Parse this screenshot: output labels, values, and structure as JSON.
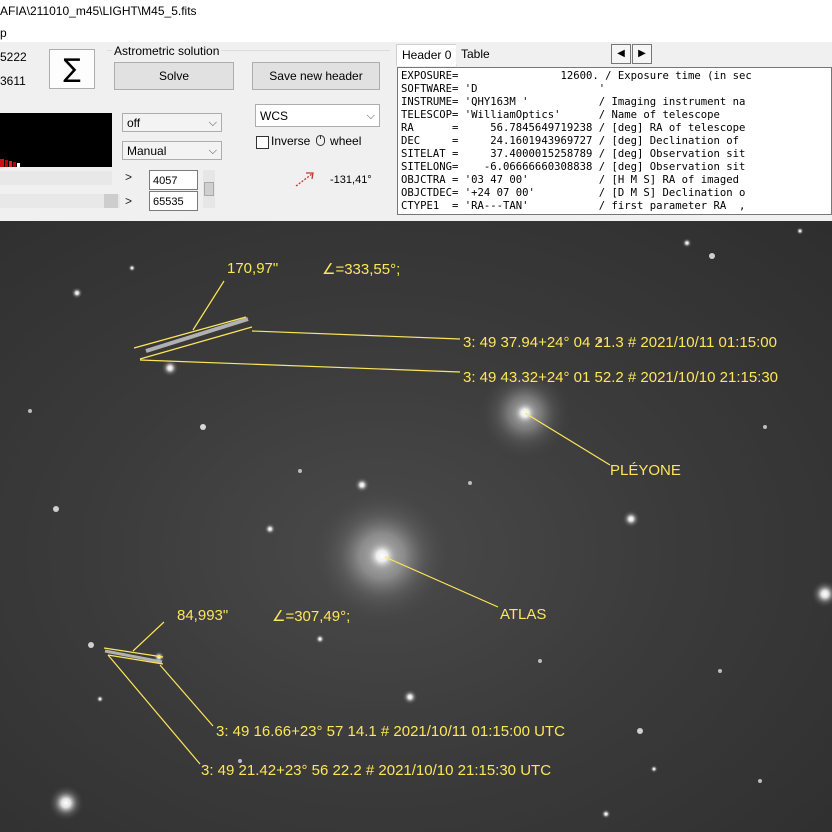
{
  "window": {
    "title": "AFIA\\211010_m45\\LIGHT\\M45_5.fits",
    "menu_item": "p"
  },
  "left_values": {
    "v1": "5222",
    "v2": "3611"
  },
  "toolbar": {
    "sigma_label": "∑",
    "astrometric_label": "Astrometric solution",
    "solve_label": "Solve",
    "save_header_label": "Save new header"
  },
  "display": {
    "stretch_value": "off",
    "range_mode": "Manual",
    "coord_mode": "WCS",
    "inverse_label": "Inverse",
    "wheel_label": "wheel",
    "min_value": "4057",
    "max_value": "65535",
    "angle_value": "-131,41°",
    "arrow_glyph": ">"
  },
  "header_panel": {
    "tabs": [
      "Header 0",
      "Table"
    ],
    "lines": [
      "EXPOSURE=                12600. / Exposure time (in sec",
      "SOFTWARE= 'D                   '",
      "INSTRUME= 'QHY163M '           / Imaging instrument na",
      "TELESCOP= 'WilliamOptics'      / Name of telescope",
      "RA      =     56.7845649719238 / [deg] RA of telescope",
      "DEC     =     24.1601943969727 / [deg] Declination of",
      "SITELAT =     37.4000015258789 / [deg] Observation sit",
      "SITELONG=    -6.06666660308838 / [deg] Observation sit",
      "OBJCTRA = '03 47 00'           / [H M S] RA of imaged",
      "OBJCTDEC= '+24 07 00'          / [D M S] Declination o",
      "CTYPE1  = 'RA---TAN'           / first parameter RA  ,"
    ]
  },
  "annotations": {
    "arc1": "170,97\"",
    "angle1": "∠=333,55°;",
    "pos1a": "3: 49  37.94+24° 04  21.3  #  2021/10/11 01:15:00",
    "pos1b": "3: 49  43.32+24° 01  52.2  #  2021/10/10 21:15:30",
    "pleyone": "PLÉYONE",
    "atlas": "ATLAS",
    "arc2": "84,993\"",
    "angle2": "∠=307,49°;",
    "pos2a": "3: 49  16.66+23° 57  14.1  #  2021/10/11 01:15:00 UTC",
    "pos2b": "3: 49  21.42+23° 56  22.2  #  2021/10/10 21:15:30 UTC"
  },
  "colors": {
    "annotation": "#fde65a",
    "sky": "#333333",
    "star": "#ffffff",
    "angle_arrow": "#c0392b"
  }
}
